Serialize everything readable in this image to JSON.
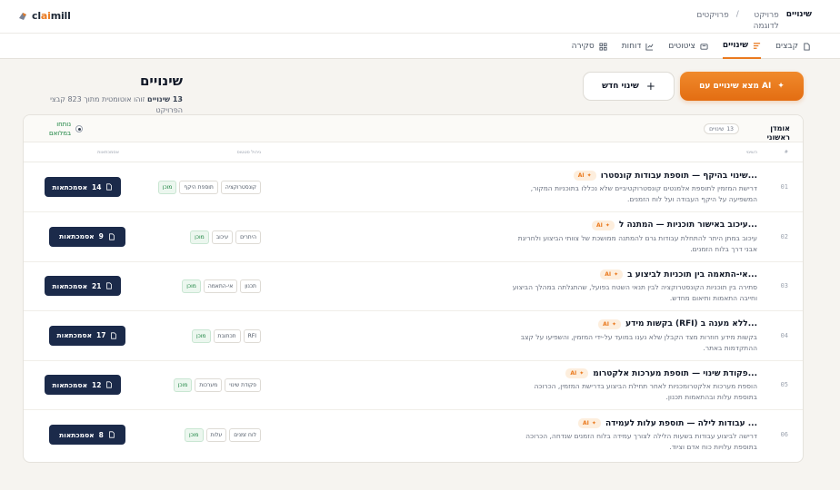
{
  "breadcrumb": {
    "current": "שינויים",
    "items": [
      "פרויקט לדוגמה",
      "פרויקטים"
    ]
  },
  "brand": {
    "pre": "cl",
    "accent": "ai",
    "post": "mill",
    "accent_color": "#ea7a1f"
  },
  "tabs": [
    {
      "label": "קבצים",
      "icon": "file-icon"
    },
    {
      "label": "שינויים",
      "icon": "list-icon",
      "active": true
    },
    {
      "label": "ציטוטים",
      "icon": "quote-icon"
    },
    {
      "label": "דוחות",
      "icon": "chart-icon"
    },
    {
      "label": "סקירה",
      "icon": "grid-icon"
    }
  ],
  "page": {
    "title": "שינויים",
    "subtitle_count": "13 שינויים",
    "subtitle_rest": "זוהו אוטומטית מתוך 823 קבצי הפרויקט"
  },
  "actions": {
    "ai_button": "מצא שינויים עם AI",
    "ai_sparkle": "✦",
    "new_button": "שינוי חדש",
    "new_plus": "+"
  },
  "card": {
    "title": "אומדן ראשוני",
    "count": "13",
    "count_label": "שינויים",
    "status": "נותחו במלואם"
  },
  "columns": {
    "num": "#",
    "change": "השינוי",
    "tags": "ניהול סטטוס",
    "assoc": "אסמכתאות"
  },
  "ai_label": "AI",
  "assoc_label": "אסמכתאות",
  "rows": [
    {
      "num": "01",
      "title": "שינוי בהיקף — תוספת עבודות קונסטרו...",
      "desc": "דרישת המזמין לתוספת אלמנטים קונסטרוקטיביים שלא נכללו בתוכניות המקור, המשפיעה על היקף העבודה ועל לוח הזמנים.",
      "tags": [
        "קונסטרוקציה",
        "תוספת היקף"
      ],
      "status": "מוכן",
      "assoc": "14"
    },
    {
      "num": "02",
      "title": "עיכוב באישור תוכניות — המתנה ל...",
      "desc": "עיכוב במתן היתר להתחלת עבודות גרם להמתנה ממושכת של צוותי הביצוע ולחריגת אבני דרך בלוח הזמנים.",
      "tags": [
        "היתרים",
        "עיכוב"
      ],
      "status": "מוכן",
      "assoc": "9"
    },
    {
      "num": "03",
      "title": "אי-התאמה בין תוכניות לביצוע ב...",
      "desc": "סתירה בין תוכניות הקונסטרוקציה לבין תנאי השטח בפועל, שהתגלתה במהלך הביצוע וחייבה התאמות ותיאום מחדש.",
      "tags": [
        "תכנון",
        "אי-התאמה"
      ],
      "status": "מוכן",
      "assoc": "21"
    },
    {
      "num": "04",
      "title": "בקשות מידע (RFI) ללא מענה ב...",
      "desc": "בקשות מידע חוזרות מצד הקבלן שלא נענו במועד על-ידי המזמין, והשפיעו על קצב ההתקדמות באתר.",
      "tags": [
        "RFI",
        "תכתובת"
      ],
      "status": "מוכן",
      "assoc": "17"
    },
    {
      "num": "05",
      "title": "פקודת שינוי — תוספת מערכות אלקטרומ...",
      "desc": "הוספת מערכות אלקטרומכניות לאחר תחילת הביצוע בדרישת המזמין, הכרוכה בתוספת עלות ובהתאמות תכנון.",
      "tags": [
        "פקודת שינוי",
        "מערכות"
      ],
      "status": "מוכן",
      "assoc": "12"
    },
    {
      "num": "06",
      "title": "עבודות לילה — תוספת עלות לעמידה ...",
      "desc": "דרישה לביצוע עבודות בשעות הלילה לצורך עמידה בלוח הזמנים שנדחה, הכרוכה בתוספת עלויות כוח אדם וציוד.",
      "tags": [
        "לוח זמנים",
        "עלות"
      ],
      "status": "מוכן",
      "assoc": "8"
    }
  ]
}
